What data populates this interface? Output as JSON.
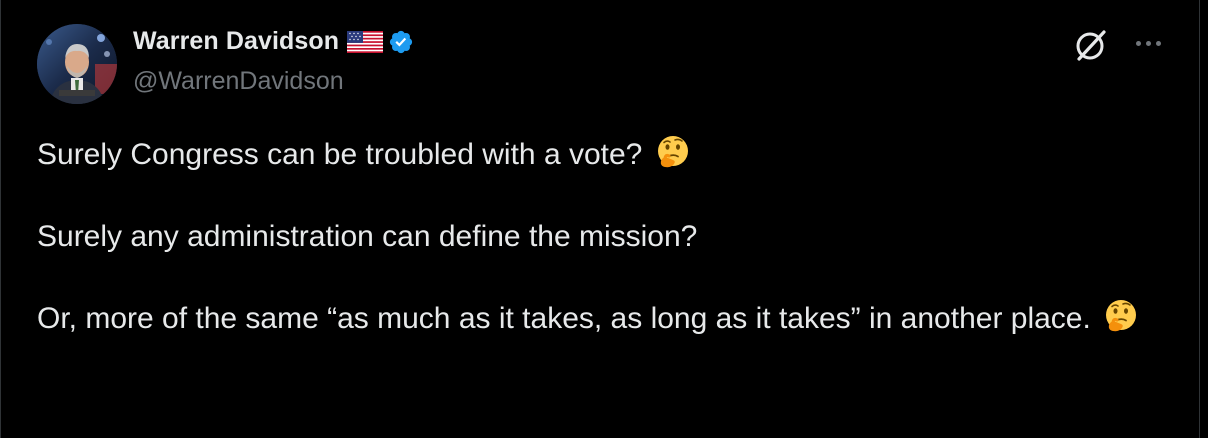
{
  "tweet": {
    "author_name": "Warren Davidson",
    "handle": "@WarrenDavidson",
    "flag_icon": "us-flag-icon",
    "verified_icon": "verified-badge-icon",
    "accent_color": "#1d9bf0",
    "paragraphs": [
      {
        "text": "Surely Congress can be troubled with a vote?",
        "emoji": "thinking-face-icon"
      },
      {
        "text": "Surely any administration can define the mission?",
        "emoji": ""
      },
      {
        "text": "Or, more of the same “as much as it takes, as long as it takes” in another place.",
        "emoji": "thinking-face-icon"
      }
    ]
  },
  "actions": {
    "grok_icon": "grok-icon",
    "more_icon": "more-options-icon"
  }
}
